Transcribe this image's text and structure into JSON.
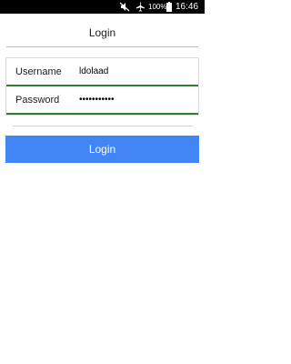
{
  "status_bar": {
    "battery_percent": "100%",
    "time": "16:46",
    "icons": [
      "mute-icon",
      "airplane-mode-icon",
      "battery-icon"
    ]
  },
  "header": {
    "title": "Login"
  },
  "form": {
    "username_label": "Username",
    "username_value": "ldolaad",
    "password_label": "Password",
    "password_value": "•••••••••••"
  },
  "actions": {
    "login_label": "Login"
  },
  "colors": {
    "accent_blue": "#4285f4",
    "underline_green": "#2e7d32"
  }
}
